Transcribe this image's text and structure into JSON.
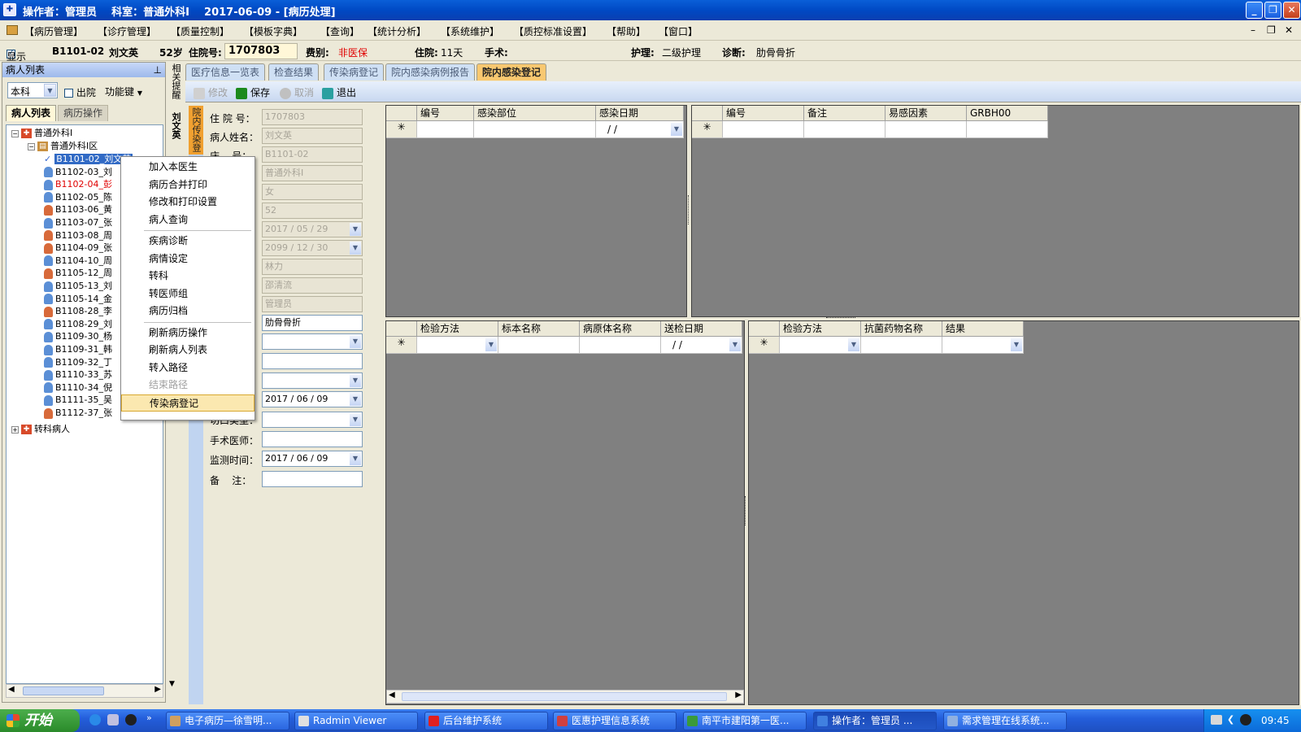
{
  "window": {
    "title": "操作者：管理员    科室：普通外科Ⅰ    2017-06-09 - [病历处理]"
  },
  "menu": [
    "【病历管理】",
    "【诊疗管理】",
    "【质量控制】",
    "【模板字典】",
    "【查询】",
    "【统计分析】",
    "【系统维护】",
    "【质控标准设置】",
    "【帮助】",
    "【窗口】"
  ],
  "patient_bar": {
    "show_label": "显示",
    "bed": "B1101-02",
    "name": "刘文英",
    "age": "52岁",
    "admission_label": "住院号:",
    "admission_no": "1707803",
    "fee_label": "费别:",
    "fee_value": "非医保",
    "days_label": "住院:",
    "days_value": "11天",
    "surgery_label": "手术:",
    "nursing_label": "护理:",
    "nursing_value": "二级护理",
    "diagnosis_label": "诊断:",
    "diagnosis_value": "肋骨骨折"
  },
  "left_panel": {
    "header": "病人列表",
    "scope": "本科",
    "discharged_label": "出院",
    "function_key": "功能键",
    "tabs": [
      "病人列表",
      "病历操作"
    ],
    "tree": {
      "root": "普通外科Ⅰ",
      "ward": "普通外科Ⅰ区",
      "patients": [
        {
          "label": "B1101-02_刘文英",
          "sex": "m",
          "selected": true
        },
        {
          "label": "B1102-03_刘",
          "sex": "m"
        },
        {
          "label": "B1102-04_彭",
          "sex": "m",
          "red": true
        },
        {
          "label": "B1102-05_陈",
          "sex": "m"
        },
        {
          "label": "B1103-06_黄",
          "sex": "f"
        },
        {
          "label": "B1103-07_张",
          "sex": "m"
        },
        {
          "label": "B1103-08_周",
          "sex": "f"
        },
        {
          "label": "B1104-09_张",
          "sex": "f"
        },
        {
          "label": "B1104-10_周",
          "sex": "m"
        },
        {
          "label": "B1105-12_周",
          "sex": "f"
        },
        {
          "label": "B1105-13_刘",
          "sex": "m"
        },
        {
          "label": "B1105-14_金",
          "sex": "m"
        },
        {
          "label": "B1108-28_李",
          "sex": "f"
        },
        {
          "label": "B1108-29_刘",
          "sex": "m"
        },
        {
          "label": "B1109-30_杨",
          "sex": "m"
        },
        {
          "label": "B1109-31_韩",
          "sex": "m"
        },
        {
          "label": "B1109-32_丁",
          "sex": "m"
        },
        {
          "label": "B1110-33_苏",
          "sex": "m"
        },
        {
          "label": "B1110-34_倪",
          "sex": "m"
        },
        {
          "label": "B1111-35_吴",
          "sex": "m"
        },
        {
          "label": "B1112-37_张",
          "sex": "f"
        }
      ],
      "transfer": "转科病人"
    }
  },
  "side_strip": {
    "label": "相关提醒",
    "patient": "刘文英"
  },
  "context_menu": [
    {
      "label": "加入本医生"
    },
    {
      "label": "病历合并打印"
    },
    {
      "label": "修改和打印设置"
    },
    {
      "label": "病人查询",
      "sep_after": true
    },
    {
      "label": "疾病诊断"
    },
    {
      "label": "病情设定"
    },
    {
      "label": "转科"
    },
    {
      "label": "转医师组"
    },
    {
      "label": "病历归档",
      "sep_after": true
    },
    {
      "label": "刷新病历操作"
    },
    {
      "label": "刷新病人列表"
    },
    {
      "label": "转入路径"
    },
    {
      "label": "结束路径",
      "disabled": true
    },
    {
      "label": "传染病登记",
      "highlight": true
    }
  ],
  "main_tabs": [
    "医疗信息一览表",
    "检查结果",
    "传染病登记",
    "院内感染病例报告",
    "院内感染登记"
  ],
  "toolbar": {
    "edit": "修改",
    "save": "保存",
    "cancel": "取消",
    "exit": "退出"
  },
  "side_badge": "院内传染登",
  "form": {
    "admission_label": "住 院 号：",
    "admission_value": "1707803",
    "name_label": "病人姓名：",
    "name_value": "刘文英",
    "bed_label": "床    号：",
    "bed_value": "B1101-02",
    "dept_value": "普通外科Ⅰ",
    "sex_value": "女",
    "age_value": "52",
    "admit_date": "2017 / 05 / 29",
    "discharge_date": "2099 / 12 / 30",
    "doctor_value": "林力",
    "director_value": "邵清流",
    "recorder_value": "管理员",
    "diagnosis_value": "肋骨骨折",
    "date_value": "2017 / 06 / 09",
    "incision_label": "切口类型：",
    "surgeon_label": "手术医师：",
    "monitor_label": "监测时间：",
    "monitor_value": "2017 / 06 / 09",
    "note_label": "备    注："
  },
  "grids": {
    "top_left": {
      "cols": [
        "编号",
        "感染部位",
        "感染日期"
      ],
      "date_placeholder": "/   /"
    },
    "top_right": {
      "cols": [
        "编号",
        "备注",
        "易感因素",
        "GRBH00"
      ]
    },
    "bottom_left": {
      "cols": [
        "检验方法",
        "标本名称",
        "病原体名称",
        "送检日期"
      ],
      "date_placeholder": "/   /"
    },
    "bottom_right": {
      "cols": [
        "检验方法",
        "抗菌药物名称",
        "结果"
      ]
    }
  },
  "taskbar": {
    "start": "开始",
    "tasks": [
      "电子病历—徐雪明...",
      "Radmin Viewer",
      "后台维护系统",
      "医惠护理信息系统",
      "南平市建阳第一医...",
      "操作者：管理员 ...",
      "需求管理在线系统..."
    ],
    "clock": "09:45"
  }
}
